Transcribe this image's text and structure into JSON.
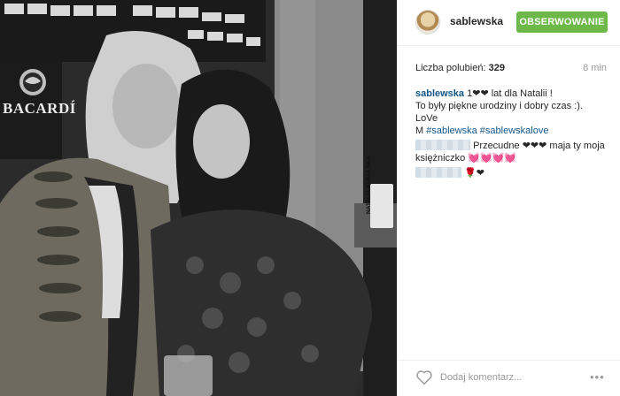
{
  "photo": {
    "bacardi_logo_text": "BACARDÍ",
    "cup_label": "NATALIA KUKULSKA"
  },
  "header": {
    "username": "sablewska",
    "follow_button": "OBSERWOWANIE"
  },
  "post": {
    "likes_label": "Liczba polubień:",
    "likes_count": "329",
    "time": "8 min"
  },
  "comments": [
    {
      "user": "sablewska",
      "line1": "1❤❤ lat dla Natalii !",
      "line2": "To były piękne urodziny i dobry czas :).",
      "line3": "LoVe",
      "line4_prefix": "M",
      "hashtag1": "#sablewska",
      "hashtag2": "#sablewskalove"
    },
    {
      "text": "Przecudne ❤❤❤ maja ty moja księżniczko 💓💓💓💓"
    },
    {
      "text": "🌹❤"
    }
  ],
  "footer": {
    "comment_placeholder": "Dodaj komentarz...",
    "more_icon": "•••"
  },
  "icons": [
    "heart-icon",
    "more-options-icon",
    "avatar"
  ],
  "colors": {
    "follow_button_bg": "#6cb849",
    "username_link": "#125688",
    "muted_text": "#999999"
  }
}
